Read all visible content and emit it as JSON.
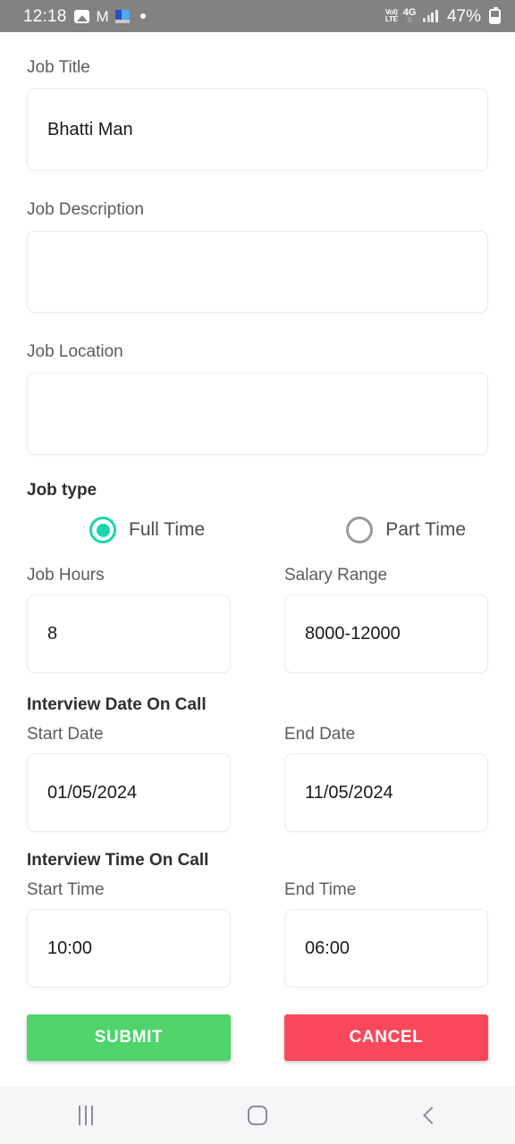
{
  "status_bar": {
    "time": "12:18",
    "icons": [
      "photos-icon",
      "gmail-icon",
      "app-badge-icon",
      "dot-icon"
    ],
    "volte_top": "Vol)",
    "volte_bottom": "LTE",
    "network": "4G",
    "network_arrows": "⇅",
    "battery_percent": "47%"
  },
  "form": {
    "job_title": {
      "label": "Job Title",
      "value": "Bhatti Man",
      "placeholder": ""
    },
    "job_description": {
      "label": "Job Description",
      "value": "",
      "placeholder": ""
    },
    "job_location": {
      "label": "Job Location",
      "value": "",
      "placeholder": ""
    },
    "job_type": {
      "label": "Job type",
      "options": [
        {
          "label": "Full Time",
          "selected": true
        },
        {
          "label": "Part Time",
          "selected": false
        }
      ],
      "selected_color": "#17d7ab"
    },
    "job_hours": {
      "label": "Job Hours",
      "value": "8",
      "placeholder": ""
    },
    "salary_range": {
      "label": "Salary Range",
      "value": "8000-12000",
      "placeholder": ""
    },
    "interview_date": {
      "heading": "Interview Date On Call",
      "start": {
        "label": "Start Date",
        "value": "01/05/2024"
      },
      "end": {
        "label": "End Date",
        "value": "11/05/2024"
      }
    },
    "interview_time": {
      "heading": "Interview Time On Call",
      "start": {
        "label": "Start Time",
        "value": "10:00"
      },
      "end": {
        "label": "End Time",
        "value": "06:00"
      }
    }
  },
  "actions": {
    "submit_label": "SUBMIT",
    "cancel_label": "CANCEL",
    "submit_color": "#4ed46b",
    "cancel_color": "#f9485b"
  },
  "navbar": {
    "recents": "recents-icon",
    "home": "home-icon",
    "back": "back-icon"
  }
}
